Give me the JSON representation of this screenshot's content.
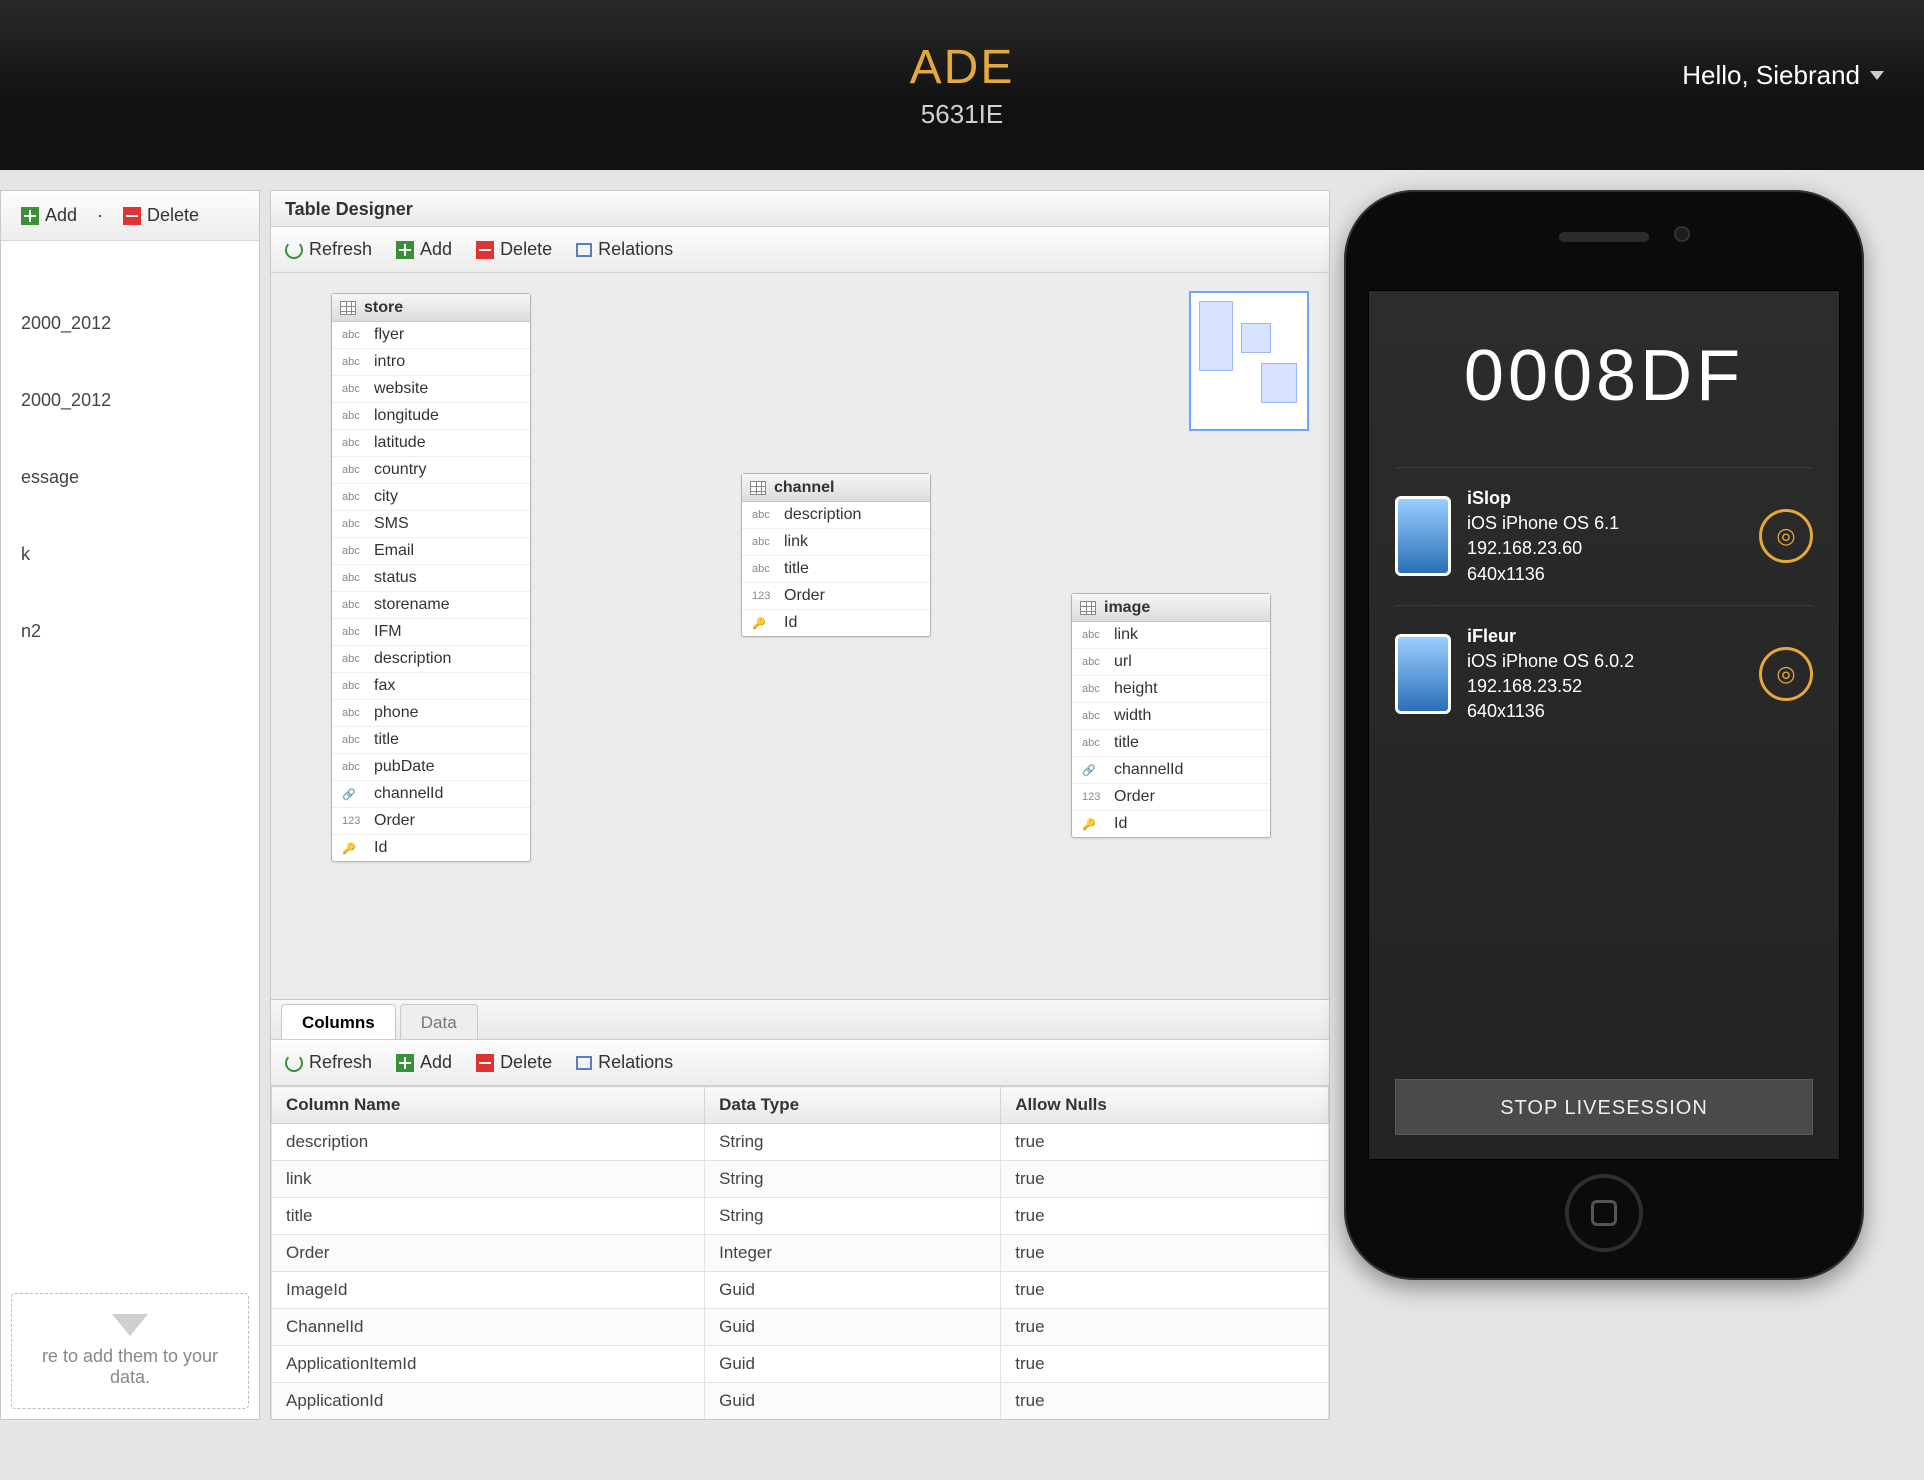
{
  "header": {
    "brand": "ADE",
    "code": "5631IE",
    "greeting": "Hello, Siebrand"
  },
  "left_panel": {
    "toolbar": {
      "add": "Add",
      "delete": "Delete"
    },
    "rows": [
      "2000_2012",
      "2000_2012",
      "essage",
      "k",
      "n2"
    ],
    "drop_hint": "re to add them to your data."
  },
  "designer": {
    "title": "Table Designer",
    "toolbar": {
      "refresh": "Refresh",
      "add": "Add",
      "delete": "Delete",
      "relations": "Relations"
    },
    "entities": {
      "store": {
        "title": "store",
        "fields": [
          "flyer",
          "intro",
          "website",
          "longitude",
          "latitude",
          "country",
          "city",
          "SMS",
          "Email",
          "status",
          "storename",
          "IFM",
          "description",
          "fax",
          "phone",
          "title",
          "pubDate",
          "channelId",
          "Order",
          "Id"
        ]
      },
      "channel": {
        "title": "channel",
        "fields": [
          "description",
          "link",
          "title",
          "Order",
          "Id"
        ]
      },
      "image": {
        "title": "image",
        "fields": [
          "link",
          "url",
          "height",
          "width",
          "title",
          "channelId",
          "Order",
          "Id"
        ]
      }
    },
    "tabs": {
      "columns": "Columns",
      "data": "Data"
    },
    "grid": {
      "headers": [
        "Column Name",
        "Data Type",
        "Allow Nulls"
      ],
      "rows": [
        {
          "name": "description",
          "type": "String",
          "nulls": "true"
        },
        {
          "name": "link",
          "type": "String",
          "nulls": "true"
        },
        {
          "name": "title",
          "type": "String",
          "nulls": "true"
        },
        {
          "name": "Order",
          "type": "Integer",
          "nulls": "true"
        },
        {
          "name": "ImageId",
          "type": "Guid",
          "nulls": "true"
        },
        {
          "name": "ChannelId",
          "type": "Guid",
          "nulls": "true"
        },
        {
          "name": "ApplicationItemId",
          "type": "Guid",
          "nulls": "true"
        },
        {
          "name": "ApplicationId",
          "type": "Guid",
          "nulls": "true"
        }
      ]
    }
  },
  "phone": {
    "session_code": "0008DF",
    "devices": [
      {
        "name": "iSlop",
        "os": "iOS iPhone OS 6.1",
        "ip": "192.168.23.60",
        "res": "640x1136"
      },
      {
        "name": "iFleur",
        "os": "iOS iPhone OS 6.0.2",
        "ip": "192.168.23.52",
        "res": "640x1136"
      }
    ],
    "stop_label": "STOP LIVESESSION"
  }
}
